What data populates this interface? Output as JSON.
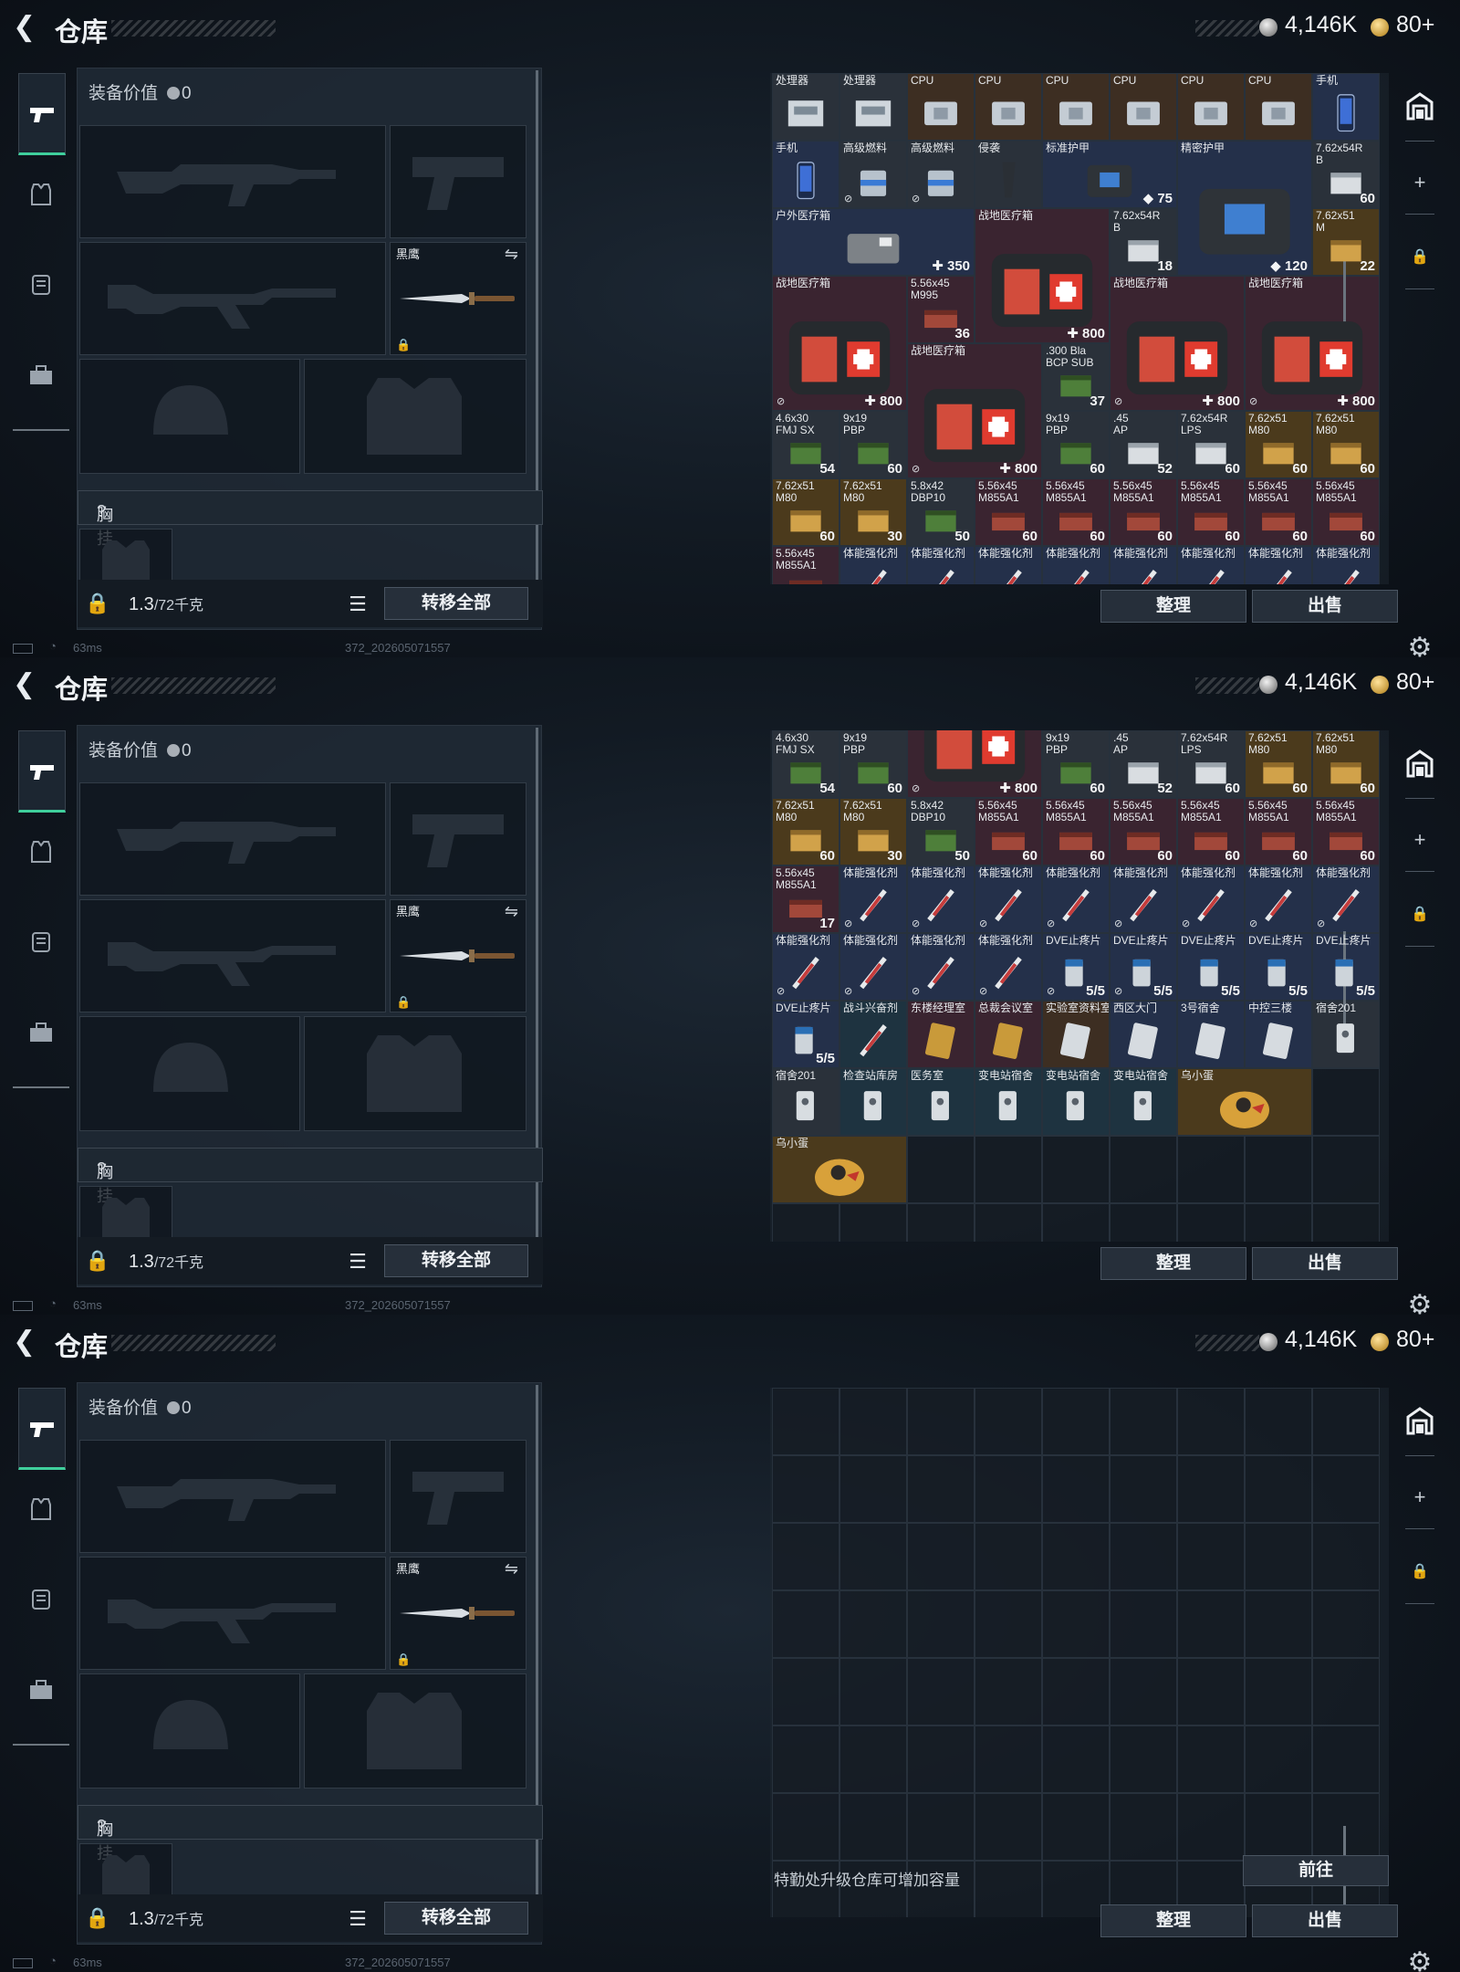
{
  "header": {
    "title": "仓库",
    "silver": "4,146K",
    "gold": "80+"
  },
  "sidebar": {
    "tabs": [
      "weapon-tab",
      "armor-tab",
      "backpack-tab",
      "case-tab"
    ]
  },
  "loadout": {
    "value_label": "装备价值",
    "value": "0",
    "knife_label": "黑鹰",
    "chest_label": "胸挂",
    "chest_help": "?",
    "weight": "1.3",
    "weight_unit": "/72千克",
    "transfer_all": "转移全部"
  },
  "actions": {
    "sort": "整理",
    "sell": "出售",
    "goto": "前往"
  },
  "upgrade_hint": "特勤处升级仓库可增加容量",
  "status": {
    "ping": "63ms",
    "version": "372_202605071557"
  },
  "colors": {
    "accent": "#3fcf9c",
    "background": "#0b0f15"
  },
  "stash_items": [
    {
      "n": "处理器",
      "c": "",
      "m": "",
      "s": "c-gray",
      "i": "cpu"
    },
    {
      "n": "处理器",
      "c": "",
      "m": "",
      "s": "c-gray",
      "i": "cpu"
    },
    {
      "n": "CPU",
      "c": "",
      "m": "",
      "s": "c-brown",
      "i": "chip"
    },
    {
      "n": "CPU",
      "c": "",
      "m": "",
      "s": "c-brown",
      "i": "chip"
    },
    {
      "n": "CPU",
      "c": "",
      "m": "",
      "s": "c-brown",
      "i": "chip"
    },
    {
      "n": "CPU",
      "c": "",
      "m": "",
      "s": "c-brown",
      "i": "chip"
    },
    {
      "n": "CPU",
      "c": "",
      "m": "",
      "s": "c-brown",
      "i": "chip"
    },
    {
      "n": "CPU",
      "c": "",
      "m": "",
      "s": "c-brown",
      "i": "chip"
    },
    {
      "n": "手机",
      "c": "",
      "m": "",
      "s": "c-blue",
      "i": "phone"
    },
    {
      "n": "手机",
      "c": "",
      "m": "",
      "s": "c-blue",
      "i": "phone"
    },
    {
      "n": "高级燃料",
      "c": "",
      "m": "⊘",
      "s": "c-gray",
      "i": "can"
    },
    {
      "n": "高级燃料",
      "c": "",
      "m": "⊘",
      "s": "c-gray",
      "i": "can"
    },
    {
      "n": "侵袭",
      "c": "",
      "m": "",
      "s": "c-gray",
      "i": "grip"
    },
    {
      "n": "标准护甲",
      "c": "◆ 75",
      "m": "",
      "s": "c-blue",
      "i": "armor",
      "w": 2
    },
    {
      "n": "精密护甲",
      "c": "◆ 120",
      "m": "",
      "s": "c-blue",
      "i": "armor",
      "w": 2,
      "h": 2
    },
    {
      "n": "户外医疗箱",
      "c": "✚ 350",
      "m": "",
      "s": "c-blue",
      "i": "medbag",
      "w": 3
    },
    {
      "n": "战地医疗箱",
      "c": "✚ 800",
      "m": "",
      "s": "c-red",
      "i": "medkit",
      "w": 2,
      "h": 2
    },
    {
      "n": "战地医疗箱",
      "c": "✚ 800",
      "m": "⊘",
      "s": "c-red",
      "i": "medkit",
      "w": 2,
      "h": 2
    },
    {
      "n": "战地医疗箱",
      "c": "✚ 800",
      "m": "⊘",
      "s": "c-red",
      "i": "medkit",
      "w": 2,
      "h": 2
    },
    {
      "n": "7.62x54R\nB",
      "c": "60",
      "m": "",
      "s": "c-gray",
      "i": "ammo-w"
    },
    {
      "n": "战地医疗箱",
      "c": "✚ 800",
      "m": "⊘",
      "s": "c-red",
      "i": "medkit",
      "w": 2,
      "h": 2
    },
    {
      "n": "战地医疗箱",
      "c": "✚ 800",
      "m": "⊘",
      "s": "c-red",
      "i": "medkit",
      "w": 2,
      "h": 2
    },
    {
      "n": "7.62x54R\nB",
      "c": "18",
      "m": "",
      "s": "c-gray",
      "i": "ammo-w"
    },
    {
      "n": "7.62x51\nM",
      "c": "22",
      "m": "",
      "s": "c-gold",
      "i": "ammo-y"
    },
    {
      "n": "5.56x45\nM995",
      "c": "36",
      "m": "",
      "s": "c-red",
      "i": "ammo-r"
    },
    {
      "n": ".300 Bla\nBCP SUB",
      "c": "37",
      "m": "",
      "s": "c-gray",
      "i": "ammo-g"
    },
    {
      "n": "4.6x30\nFMJ SX",
      "c": "54",
      "m": "",
      "s": "c-gray",
      "i": "ammo-g"
    },
    {
      "n": "9x19\nPBP",
      "c": "60",
      "m": "",
      "s": "c-gray",
      "i": "ammo-g"
    },
    {
      "n": "9x19\nPBP",
      "c": "60",
      "m": "",
      "s": "c-gray",
      "i": "ammo-g"
    },
    {
      "n": ".45\nAP",
      "c": "52",
      "m": "",
      "s": "c-gray",
      "i": "ammo-w"
    },
    {
      "n": "7.62x54R\nLPS",
      "c": "60",
      "m": "",
      "s": "c-gray",
      "i": "ammo-w"
    },
    {
      "n": "7.62x51\nM80",
      "c": "60",
      "m": "",
      "s": "c-gold",
      "i": "ammo-y"
    },
    {
      "n": "7.62x51\nM80",
      "c": "60",
      "m": "",
      "s": "c-gold",
      "i": "ammo-y"
    },
    {
      "n": "7.62x51\nM80",
      "c": "60",
      "m": "",
      "s": "c-gold",
      "i": "ammo-y"
    },
    {
      "n": "7.62x51\nM80",
      "c": "30",
      "m": "",
      "s": "c-gold",
      "i": "ammo-y"
    },
    {
      "n": "5.8x42\nDBP10",
      "c": "50",
      "m": "",
      "s": "c-gray",
      "i": "ammo-g"
    },
    {
      "n": "5.56x45\nM855A1",
      "c": "60",
      "m": "",
      "s": "c-red",
      "i": "ammo-r"
    },
    {
      "n": "5.56x45\nM855A1",
      "c": "60",
      "m": "",
      "s": "c-red",
      "i": "ammo-r"
    },
    {
      "n": "5.56x45\nM855A1",
      "c": "60",
      "m": "",
      "s": "c-red",
      "i": "ammo-r"
    },
    {
      "n": "5.56x45\nM855A1",
      "c": "60",
      "m": "",
      "s": "c-red",
      "i": "ammo-r"
    },
    {
      "n": "5.56x45\nM855A1",
      "c": "60",
      "m": "",
      "s": "c-red",
      "i": "ammo-r"
    },
    {
      "n": "5.56x45\nM855A1",
      "c": "60",
      "m": "",
      "s": "c-red",
      "i": "ammo-r"
    },
    {
      "n": "5.56x45\nM855A1",
      "c": "17",
      "m": "",
      "s": "c-red",
      "i": "ammo-r"
    },
    {
      "n": "体能强化剂",
      "c": "",
      "m": "⊘",
      "s": "c-blue",
      "i": "syringe"
    },
    {
      "n": "体能强化剂",
      "c": "",
      "m": "⊘",
      "s": "c-blue",
      "i": "syringe"
    },
    {
      "n": "体能强化剂",
      "c": "",
      "m": "⊘",
      "s": "c-blue",
      "i": "syringe"
    },
    {
      "n": "体能强化剂",
      "c": "",
      "m": "⊘",
      "s": "c-blue",
      "i": "syringe"
    },
    {
      "n": "体能强化剂",
      "c": "",
      "m": "⊘",
      "s": "c-blue",
      "i": "syringe"
    },
    {
      "n": "体能强化剂",
      "c": "",
      "m": "⊘",
      "s": "c-blue",
      "i": "syringe"
    },
    {
      "n": "体能强化剂",
      "c": "",
      "m": "⊘",
      "s": "c-blue",
      "i": "syringe"
    },
    {
      "n": "体能强化剂",
      "c": "",
      "m": "⊘",
      "s": "c-blue",
      "i": "syringe"
    },
    {
      "n": "体能强化剂",
      "c": "",
      "m": "⊘",
      "s": "c-blue",
      "i": "syringe"
    },
    {
      "n": "体能强化剂",
      "c": "",
      "m": "⊘",
      "s": "c-blue",
      "i": "syringe"
    },
    {
      "n": "体能强化剂",
      "c": "",
      "m": "⊘",
      "s": "c-blue",
      "i": "syringe"
    },
    {
      "n": "体能强化剂",
      "c": "",
      "m": "⊘",
      "s": "c-blue",
      "i": "syringe"
    },
    {
      "n": "DVE止疼片",
      "c": "5/5",
      "m": "⊘",
      "s": "c-blue",
      "i": "pill"
    },
    {
      "n": "DVE止疼片",
      "c": "5/5",
      "m": "⊘",
      "s": "c-blue",
      "i": "pill"
    },
    {
      "n": "DVE止疼片",
      "c": "5/5",
      "m": "",
      "s": "c-blue",
      "i": "pill"
    },
    {
      "n": "DVE止疼片",
      "c": "5/5",
      "m": "",
      "s": "c-blue",
      "i": "pill"
    },
    {
      "n": "DVE止疼片",
      "c": "5/5",
      "m": "",
      "s": "c-blue",
      "i": "pill"
    },
    {
      "n": "DVE止疼片",
      "c": "5/5",
      "m": "",
      "s": "c-blue",
      "i": "pill"
    },
    {
      "n": "战斗兴奋剂",
      "c": "",
      "m": "",
      "s": "c-teal",
      "i": "syringe"
    },
    {
      "n": "东楼经理室",
      "c": "",
      "m": "",
      "s": "c-red",
      "i": "card-gold"
    },
    {
      "n": "总裁会议室",
      "c": "",
      "m": "",
      "s": "c-red",
      "i": "card-gold"
    },
    {
      "n": "实验室资料室",
      "c": "",
      "m": "",
      "s": "c-brown",
      "i": "card"
    },
    {
      "n": "西区大门",
      "c": "",
      "m": "",
      "s": "c-blue",
      "i": "card"
    },
    {
      "n": "3号宿舍",
      "c": "",
      "m": "",
      "s": "c-blue",
      "i": "card"
    },
    {
      "n": "中控三楼",
      "c": "",
      "m": "",
      "s": "c-blue",
      "i": "card"
    },
    {
      "n": "宿舍201",
      "c": "",
      "m": "",
      "s": "c-gray",
      "i": "key"
    },
    {
      "n": "宿舍201",
      "c": "",
      "m": "",
      "s": "c-gray",
      "i": "key"
    },
    {
      "n": "检查站库房",
      "c": "",
      "m": "",
      "s": "c-teal",
      "i": "key"
    },
    {
      "n": "医务室",
      "c": "",
      "m": "",
      "s": "c-teal",
      "i": "key"
    },
    {
      "n": "变电站宿舍",
      "c": "",
      "m": "",
      "s": "c-teal",
      "i": "key"
    },
    {
      "n": "变电站宿舍",
      "c": "",
      "m": "",
      "s": "c-teal",
      "i": "key"
    },
    {
      "n": "变电站宿舍",
      "c": "",
      "m": "",
      "s": "c-teal",
      "i": "key"
    },
    {
      "n": "乌小蛋",
      "c": "",
      "m": "",
      "s": "c-gold",
      "i": "egg",
      "w": 2
    },
    {
      "n": "乌小蛋",
      "c": "",
      "m": "",
      "s": "c-gold",
      "i": "egg",
      "w": 2
    }
  ]
}
